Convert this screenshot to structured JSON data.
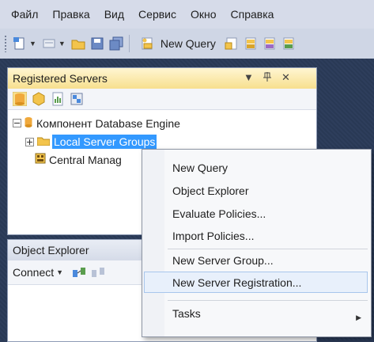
{
  "menubar": {
    "items": [
      "Файл",
      "Правка",
      "Вид",
      "Сервис",
      "Окно",
      "Справка"
    ]
  },
  "toolbar": {
    "new_query_label": "New Query"
  },
  "registered_servers": {
    "title": "Registered Servers",
    "pin": "  ",
    "tree": {
      "root": "Компонент Database Engine",
      "local_group": "Local Server Groups",
      "central": "Central Manag"
    }
  },
  "object_explorer": {
    "title": "Object Explorer",
    "connect_label": "Connect"
  },
  "context_menu": {
    "items": [
      "New Query",
      "Object Explorer",
      "Evaluate Policies...",
      "Import Policies...",
      "New Server Group...",
      "New Server Registration...",
      "Tasks"
    ],
    "highlighted_index": 5
  },
  "colors": {
    "accent_selection": "#3399ff",
    "panel_title_active": "#f7df8e",
    "workspace": "#293955"
  }
}
